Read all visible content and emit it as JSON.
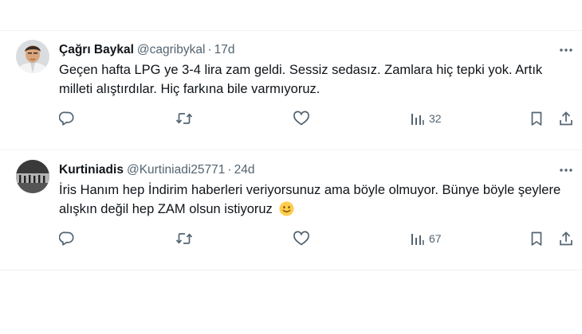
{
  "tweets": [
    {
      "author_name": "Çağrı Baykal",
      "handle": "@cagribykal",
      "separator": "·",
      "time": "17d",
      "text": "Geçen hafta LPG ye 3-4 lira zam geldi. Sessiz sedasız. Zamlara hiç tepki yok. Artık milleti alıştırdılar. Hiç farkına bile varmıyoruz.",
      "views": "32"
    },
    {
      "author_name": "Kurtiniadis",
      "handle": "@Kurtiniadi25771",
      "separator": "·",
      "time": "24d",
      "text": "İris Hanım hep İndirim haberleri veriyorsunuz ama böyle olmuyor. Bünye böyle şeylere alışkın değil hep ZAM olsun istiyoruz",
      "emoji": "🙂",
      "views": "67"
    }
  ],
  "icons": {
    "more": "more-dots-icon",
    "reply": "reply-icon",
    "retweet": "retweet-icon",
    "like": "like-heart-icon",
    "views": "views-bar-chart-icon",
    "bookmark": "bookmark-icon",
    "share": "share-icon"
  },
  "colors": {
    "text": "#0f1419",
    "secondary": "#536471",
    "divider": "#eff3f4",
    "emoji": "#ffcc4d"
  }
}
